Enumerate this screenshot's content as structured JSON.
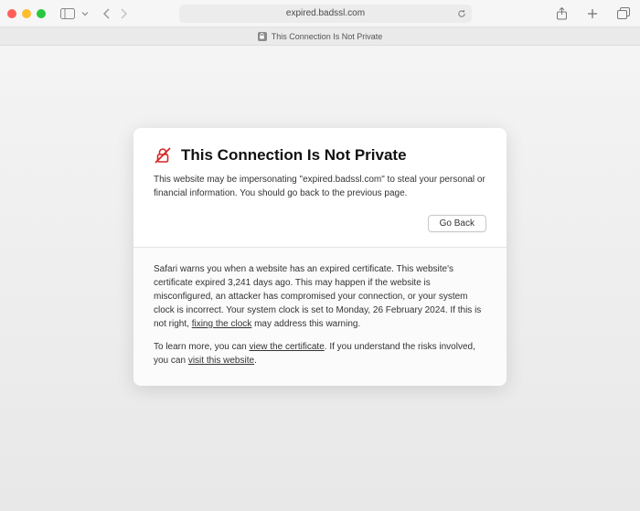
{
  "toolbar": {
    "address": "expired.badssl.com"
  },
  "tab": {
    "title": "This Connection Is Not Private"
  },
  "panel": {
    "heading": "This Connection Is Not Private",
    "body": "This website may be impersonating \"expired.badssl.com\" to steal your personal or financial information. You should go back to the previous page.",
    "go_back": "Go Back",
    "detail_1a": "Safari warns you when a website has an expired certificate. This website's certificate expired 3,241 days ago. This may happen if the website is misconfigured, an attacker has compromised your connection, or your system clock is incorrect. Your system clock is set to Monday, 26 February 2024. If this is not right, ",
    "fixing_clock": "fixing the clock",
    "detail_1b": " may address this warning.",
    "detail_2a": "To learn more, you can ",
    "view_cert": "view the certificate",
    "detail_2b": ". If you understand the risks involved, you can ",
    "visit_site": "visit this website",
    "detail_2c": "."
  }
}
